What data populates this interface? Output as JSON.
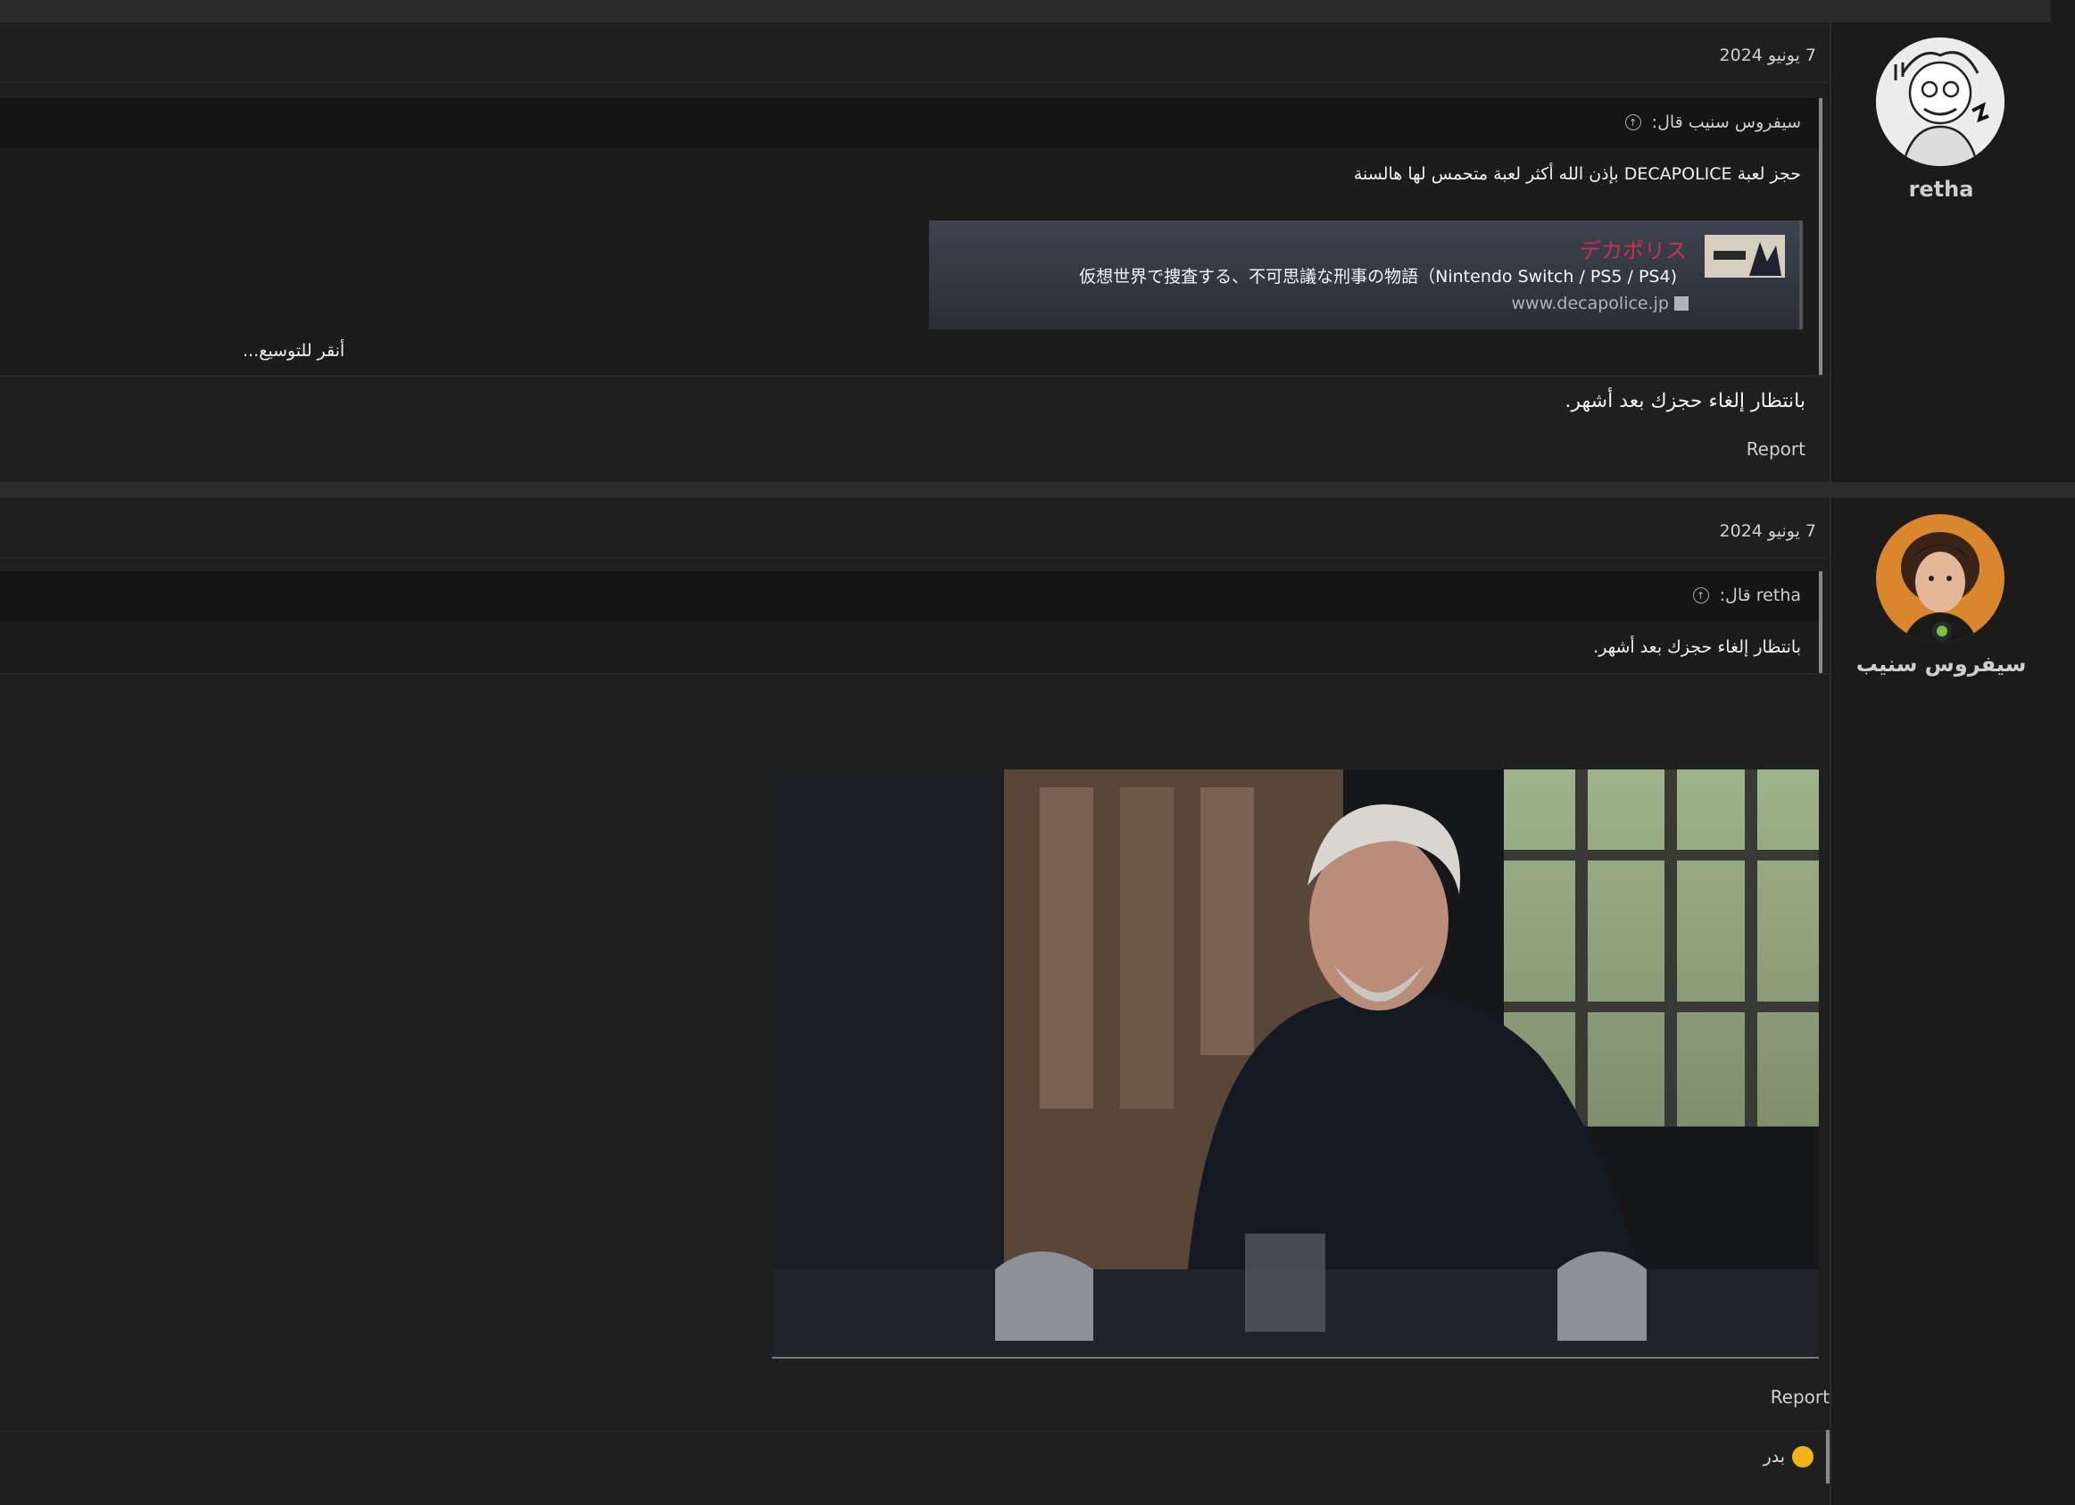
{
  "posts": [
    {
      "username": "retha",
      "date": "7 يونيو 2024",
      "quote": {
        "author_line": "سيفروس سنيب قال:",
        "body": "حجز لعبة DECAPOLICE بإذن الله أكثر لعبة متحمس لها هالسنة",
        "embed": {
          "title": "デカポリス",
          "description": "仮想世界で捜査する、不可思議な刑事の物語（Nintendo Switch / PS5 / PS4)",
          "site": "www.decapolice.jp"
        },
        "expand_label": "أنقر للتوسيع..."
      },
      "message": "بانتظار إلغاء حجزك بعد أشهر.",
      "report_label": "Report"
    },
    {
      "username": "سيفروس سنيب",
      "date": "7 يونيو 2024",
      "quote": {
        "author_line": "retha قال:",
        "body": "بانتظار إلغاء حجزك بعد أشهر."
      },
      "report_label": "Report",
      "reaction": {
        "icon": "laughing-emoji",
        "user": "بدر"
      }
    }
  ],
  "colors": {
    "background": "#1e1e1e",
    "embed_title": "#c9314a",
    "online": "#7bc144"
  }
}
